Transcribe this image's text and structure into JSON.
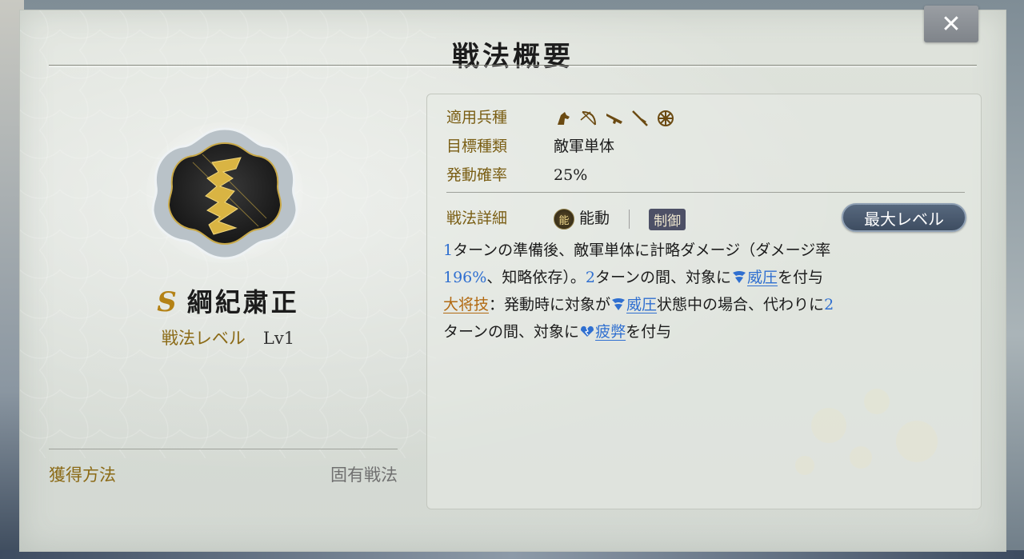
{
  "dialog": {
    "title": "戦法概要",
    "close_label": "✕"
  },
  "skill": {
    "rank": "S",
    "name": "綱紀粛正",
    "level_label": "戦法レベル",
    "level_value": "Lv1",
    "acquire_label": "獲得方法",
    "acquire_value": "固有戦法"
  },
  "info": {
    "troop_label": "適用兵種",
    "troop_icons": [
      "cavalry-icon",
      "bow-icon",
      "gun-icon",
      "spear-icon",
      "wheel-icon"
    ],
    "target_label": "目標種類",
    "target_value": "敵軍単体",
    "rate_label": "発動確率",
    "rate_value": "25%",
    "detail_label": "戦法詳細",
    "kind_icon": "能",
    "kind_value": "能動",
    "type_badge": "制御",
    "max_level_button": "最大レベル"
  },
  "description": {
    "l1_n1": "1",
    "l1_t1": "ターンの準備後、敵軍単体に計略ダメージ（ダメージ率",
    "l2_n1": "196%",
    "l2_t1": "、知略依存）。",
    "l2_n2": "2",
    "l2_t2": "ターンの間、対象に",
    "l2_kw": "威圧",
    "l2_t3": "を付与",
    "l3_kw": "大将技",
    "l3_t1": "：発動時に対象が",
    "l3_kw2": "威圧",
    "l3_t2": "状態中の場合、代わりに",
    "l3_n1": "2",
    "l4_t1": "ターンの間、対象に",
    "l4_kw": "疲弊",
    "l4_t2": "を付与"
  },
  "colors": {
    "accent_gold": "#8b6a16",
    "number_blue": "#2f6fd0",
    "keyword_orange": "#b26a12"
  }
}
